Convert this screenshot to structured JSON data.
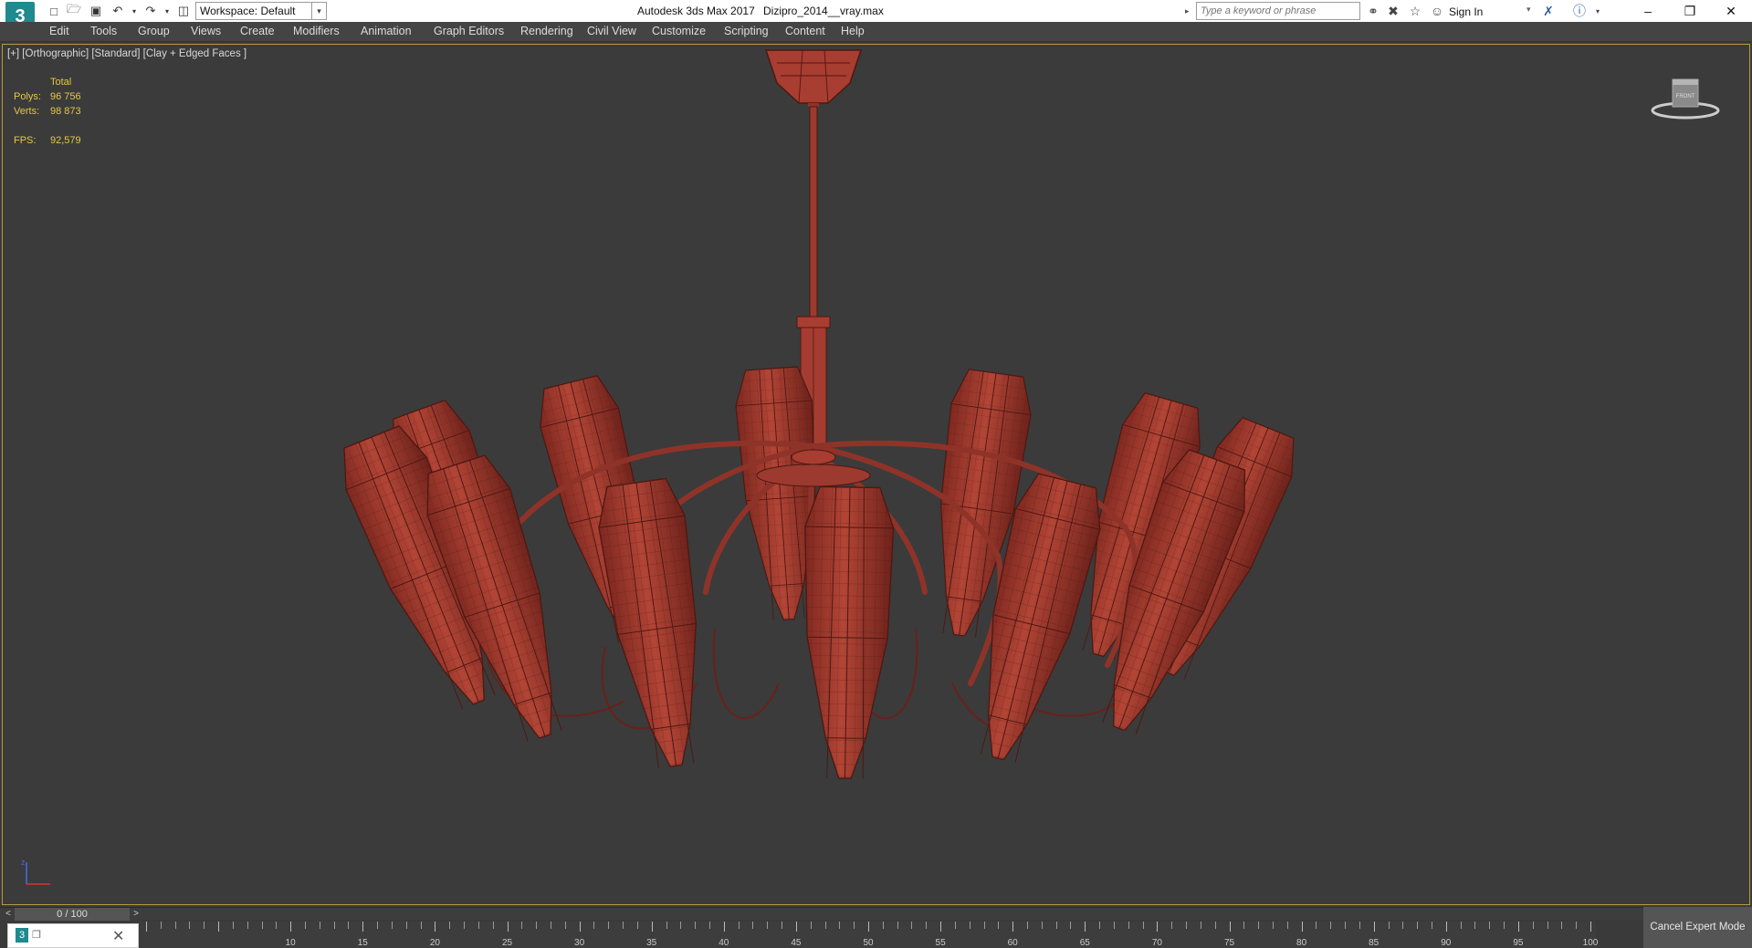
{
  "title_bar": {
    "logo_text": "3",
    "workspace_label": "Workspace: Default",
    "app_title": "Autodesk 3ds Max 2017",
    "document_title": "Dizipro_2014__vray.max",
    "search_placeholder": "Type a keyword or phrase",
    "sign_in_label": "Sign In"
  },
  "menu": {
    "items": [
      "Edit",
      "Tools",
      "Group",
      "Views",
      "Create",
      "Modifiers",
      "Animation",
      "Graph Editors",
      "Rendering",
      "Civil View",
      "Customize",
      "Scripting",
      "Content",
      "Help"
    ]
  },
  "viewport": {
    "label": "[+] [Orthographic] [Standard] [Clay + Edged Faces ]",
    "stats": {
      "header": "Total",
      "polys_label": "Polys:",
      "polys_value": "96 756",
      "verts_label": "Verts:",
      "verts_value": "98 873",
      "fps_label": "FPS:",
      "fps_value": "92,579"
    },
    "viewcube_label": "FRONT",
    "model_color": "#a93e32",
    "background_color": "#3b3b3b"
  },
  "timeline": {
    "frame_display": "0 / 100",
    "ruler_labels": [
      "10",
      "15",
      "20",
      "25",
      "30",
      "35",
      "40",
      "45",
      "50",
      "55",
      "60",
      "65",
      "70",
      "75",
      "80",
      "85",
      "90",
      "95",
      "100"
    ]
  },
  "status": {
    "cancel_expert_mode": "Cancel Expert Mode"
  },
  "colors": {
    "accent_teal": "#1f8a8f",
    "stats_yellow": "#e6c844",
    "viewport_border": "#b89a3a"
  }
}
